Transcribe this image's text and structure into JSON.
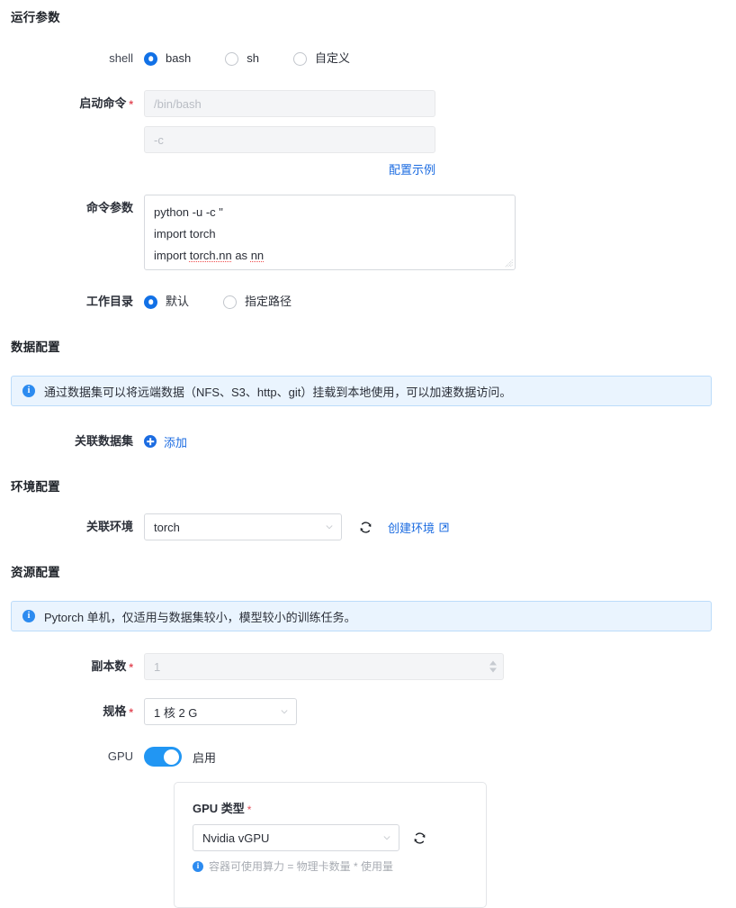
{
  "sections": {
    "run_params": "运行参数",
    "data_config": "数据配置",
    "env_config": "环境配置",
    "resource_config": "资源配置"
  },
  "shell": {
    "label": "shell",
    "options": [
      {
        "label": "bash",
        "selected": true
      },
      {
        "label": "sh",
        "selected": false
      },
      {
        "label": "自定义",
        "selected": false
      }
    ]
  },
  "start_command": {
    "label": "启动命令",
    "required": true,
    "line1_placeholder": "/bin/bash",
    "line1_value": "",
    "line2_placeholder": "-c",
    "line2_value": "",
    "example_link": "配置示例"
  },
  "command_args": {
    "label": "命令参数",
    "lines": [
      "python -u -c \"",
      "import torch",
      "import torch.nn as nn"
    ],
    "misspelled": [
      "torch.nn",
      "nn"
    ]
  },
  "workdir": {
    "label": "工作目录",
    "options": [
      {
        "label": "默认",
        "selected": true
      },
      {
        "label": "指定路径",
        "selected": false
      }
    ]
  },
  "dataset_alert": "通过数据集可以将远端数据（NFS、S3、http、git）挂载到本地使用，可以加速数据访问。",
  "dataset": {
    "label": "关联数据集",
    "add_label": "添加"
  },
  "environment": {
    "label": "关联环境",
    "value": "torch",
    "create_link": "创建环境"
  },
  "resource_alert": "Pytorch 单机，仅适用与数据集较小，模型较小的训练任务。",
  "replicas": {
    "label": "副本数",
    "required": true,
    "value": "1"
  },
  "spec": {
    "label": "规格",
    "required": true,
    "value": "1 核 2 G"
  },
  "gpu": {
    "label": "GPU",
    "enabled": true,
    "toggle_text": "启用",
    "type_label": "GPU 类型",
    "type_required": true,
    "type_value": "Nvidia vGPU",
    "hint": "容器可使用算力 = 物理卡数量 * 使用量"
  },
  "colors": {
    "accent": "#1271e6",
    "link": "#1c6ce1",
    "toggle_on": "#2196f3",
    "required": "#e34d59",
    "alert_bg": "#eaf4fe",
    "alert_border": "#bcdcfa"
  }
}
